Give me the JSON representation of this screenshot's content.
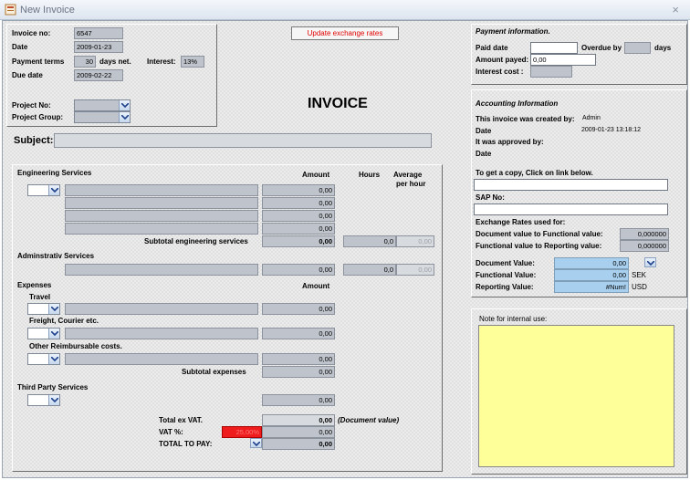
{
  "window": {
    "title": "New Invoice",
    "close_glyph": "×"
  },
  "header": {
    "invoice_no_label": "Invoice no:",
    "invoice_no": "6547",
    "date_label": "Date",
    "date": "2009-01-23",
    "payment_terms_label": "Payment terms",
    "payment_terms": "30",
    "days_net_label": "days net.",
    "interest_label": "Interest:",
    "interest": "13%",
    "due_date_label": "Due date",
    "due_date": "2009-02-22",
    "project_no_label": "Project No:",
    "project_group_label": "Project Group:"
  },
  "update_button": "Update exchange rates",
  "invoice_title": "INVOICE",
  "subject_label": "Subject:",
  "payment": {
    "title": "Payment information.",
    "paid_date_label": "Paid date",
    "overdue_by_label": "Overdue by",
    "days_label": "days",
    "amount_payed_label": "Amount payed:",
    "amount_payed": "0,00",
    "interest_cost_label": "Interest cost :"
  },
  "accounting": {
    "title": "Accounting Information",
    "created_by_label": "This invoice was created by:",
    "created_by": "Admin",
    "date_label": "Date",
    "date": "2009-01-23 13:18:12",
    "approved_by_label": "It was approved by:",
    "date2_label": "Date",
    "copy_label": "To get a copy, Click on link below.",
    "sap_label": "SAP No:",
    "rates_label": "Exchange  Rates used for:",
    "doc_to_func_label": "Document value to Functional value:",
    "doc_to_func": "0,000000",
    "func_to_rep_label": "Functional value to Reporting value:",
    "func_to_rep": "0,000000",
    "doc_value_label": "Document Value:",
    "doc_value": "0,00",
    "func_value_label": "Functional Value:",
    "func_value": "0,00",
    "func_currency": "SEK",
    "rep_value_label": "Reporting Value:",
    "rep_value": "#Num!",
    "rep_currency": "USD"
  },
  "note_label": "Note for internal use:",
  "services": {
    "engineering_label": "Engineering Services",
    "amount_header": "Amount",
    "hours_header": "Hours",
    "avg_header_1": "Average",
    "avg_header_2": "per hour",
    "eng_amounts": [
      "0,00",
      "0,00",
      "0,00",
      "0,00"
    ],
    "subtotal_eng_label": "Subtotal engineering services",
    "subtotal_eng": "0,00",
    "eng_hours": "0,0",
    "eng_avg": "0,00",
    "admin_label": "Adminstrativ Services",
    "admin_amount": "0,00",
    "admin_hours": "0,0",
    "admin_avg": "0,00",
    "expenses_label": "Expenses",
    "exp_amount_header": "Amount",
    "travel_label": "Travel",
    "travel_amount": "0,00",
    "freight_label": "Freight, Courier etc.",
    "freight_amount": "0,00",
    "other_label": "Other Reimbursable costs.",
    "other_amount": "0,00",
    "subtotal_exp_label": "Subtotal  expenses",
    "subtotal_exp": "0,00",
    "third_label": "Third Party Services",
    "third_amount": "0,00"
  },
  "totals": {
    "total_ex_vat_label": "Total ex VAT.",
    "total_ex_vat": "0,00",
    "doc_value_note": "(Document value)",
    "vat_label": "VAT  %:",
    "vat_pct": "25,00%",
    "vat_amount": "0,00",
    "total_to_pay_label": "TOTAL TO PAY:",
    "total_to_pay": "0,00"
  },
  "colors": {
    "note_bg": "#ffff99",
    "button_text": "#e00000",
    "vat_bg": "#ee1c1c",
    "blue_field": "#a8d0ee"
  },
  "icons": [
    "form-icon",
    "close-icon",
    "chevron-down-icon"
  ]
}
